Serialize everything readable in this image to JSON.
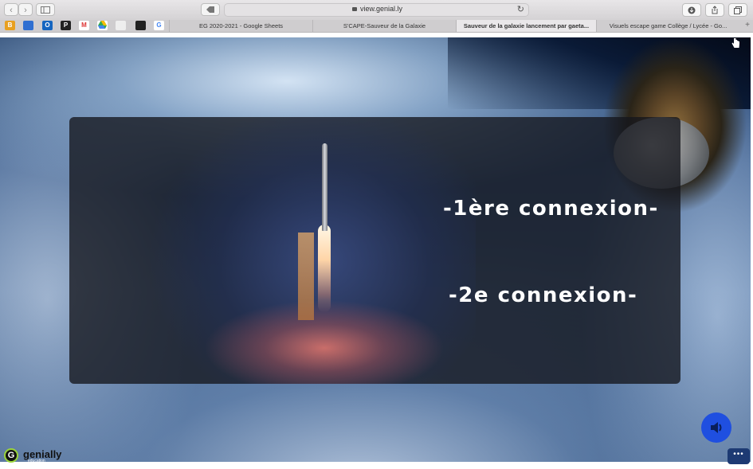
{
  "browser": {
    "url": "view.genial.ly",
    "tabs": [
      {
        "label": "EG 2020-2021 - Google Sheets",
        "active": false
      },
      {
        "label": "S'CAPE-Sauveur de la Galaxie",
        "active": false
      },
      {
        "label": "Sauveur de la galaxie lancement par gaeta...",
        "active": true
      },
      {
        "label": "Visuels escape game Collège / Lycée - Go...",
        "active": false
      }
    ],
    "favorites": [
      "B",
      "",
      "O",
      "P",
      "M",
      "",
      "",
      "",
      "G"
    ],
    "colors": {
      "chrome": "#d4d2d4",
      "tab_active": "#e9e7e9"
    }
  },
  "presentation": {
    "buttons": {
      "first_connection": "-1ère connexion-",
      "second_connection": "-2e connexion-"
    },
    "logo": {
      "name": "genially",
      "sub": "education"
    },
    "icons": [
      "speaker-icon",
      "more-dots-icon",
      "hand-pointer-icon",
      "g-logo-icon"
    ],
    "colors": {
      "audio_button": "#1f4fe0",
      "panel": "rgba(20,22,28,0.78)",
      "text": "#ffffff"
    }
  }
}
